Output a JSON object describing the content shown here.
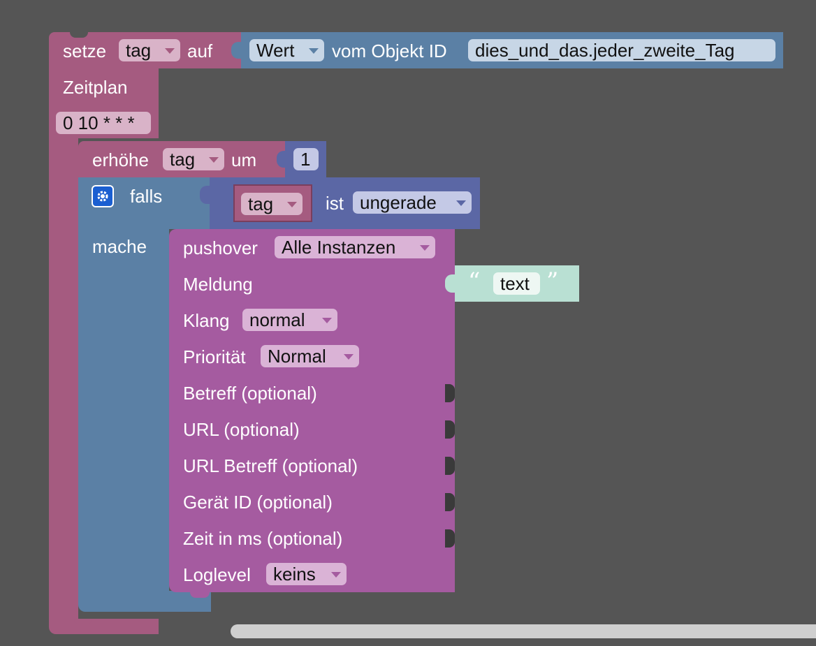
{
  "set_block": {
    "keyword": "setze",
    "variable": "tag",
    "keyword_to": "auf",
    "value_mode": "Wert",
    "value_label": "vom Objekt ID",
    "object_id": "dies_und_das.jeder_zweite_Tag"
  },
  "schedule_block": {
    "label": "Zeitplan",
    "cron": "0 10 * * *"
  },
  "increment_block": {
    "keyword": "erhöhe",
    "variable": "tag",
    "keyword_by": "um",
    "amount": "1"
  },
  "if_block": {
    "keyword_if": "falls",
    "keyword_do": "mache",
    "condition": {
      "variable": "tag",
      "keyword_is": "ist",
      "property": "ungerade"
    }
  },
  "pushover_block": {
    "label": "pushover",
    "instance": "Alle Instanzen",
    "message_label": "Meldung",
    "message_text": "text",
    "sound_label": "Klang",
    "sound": "normal",
    "priority_label": "Priorität",
    "priority": "Normal",
    "subject_label": "Betreff (optional)",
    "url_label": "URL (optional)",
    "url_title_label": "URL Betreff (optional)",
    "device_label": "Gerät ID (optional)",
    "time_label": "Zeit in ms (optional)",
    "loglevel_label": "Loglevel",
    "loglevel": "keins"
  },
  "colors": {
    "variables": "#a55b80",
    "values": "#5b80a5",
    "math": "#5b67a5",
    "pushover": "#a55ba0",
    "text": "#b9e0d3",
    "workspace": "#555555"
  }
}
